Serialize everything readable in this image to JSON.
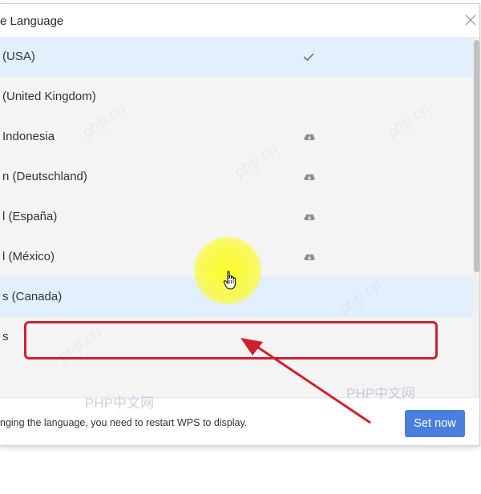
{
  "dialog": {
    "title": "e Language",
    "close_icon": "close-icon"
  },
  "languages": [
    {
      "label": "(USA)",
      "status": "selected",
      "icon": "checkmark-icon"
    },
    {
      "label": "(United Kingdom)",
      "status": "installed",
      "icon": ""
    },
    {
      "label": "Indonesia",
      "status": "downloadable",
      "icon": "cloud-download-icon"
    },
    {
      "label": "n (Deutschland)",
      "status": "downloadable",
      "icon": "cloud-download-icon"
    },
    {
      "label": "l (España)",
      "status": "downloadable",
      "icon": "cloud-download-icon"
    },
    {
      "label": "l (México)",
      "status": "downloadable",
      "icon": "cloud-download-icon"
    },
    {
      "label": "s (Canada)",
      "status": "hover",
      "icon": ""
    },
    {
      "label": "s",
      "status": "installed",
      "icon": ""
    }
  ],
  "footer": {
    "notice": "nging the language, you need to restart WPS to display.",
    "set_now_label": "Set now"
  },
  "watermarks": {
    "left": "PHP中文网",
    "right": "PHP中文网",
    "diagonal": "php.cn"
  },
  "colors": {
    "selected_bg": "#e2effc",
    "primary_button": "#4a7fe0",
    "annotation_red": "#d11f2e",
    "highlight_yellow": "#ffff1e"
  }
}
